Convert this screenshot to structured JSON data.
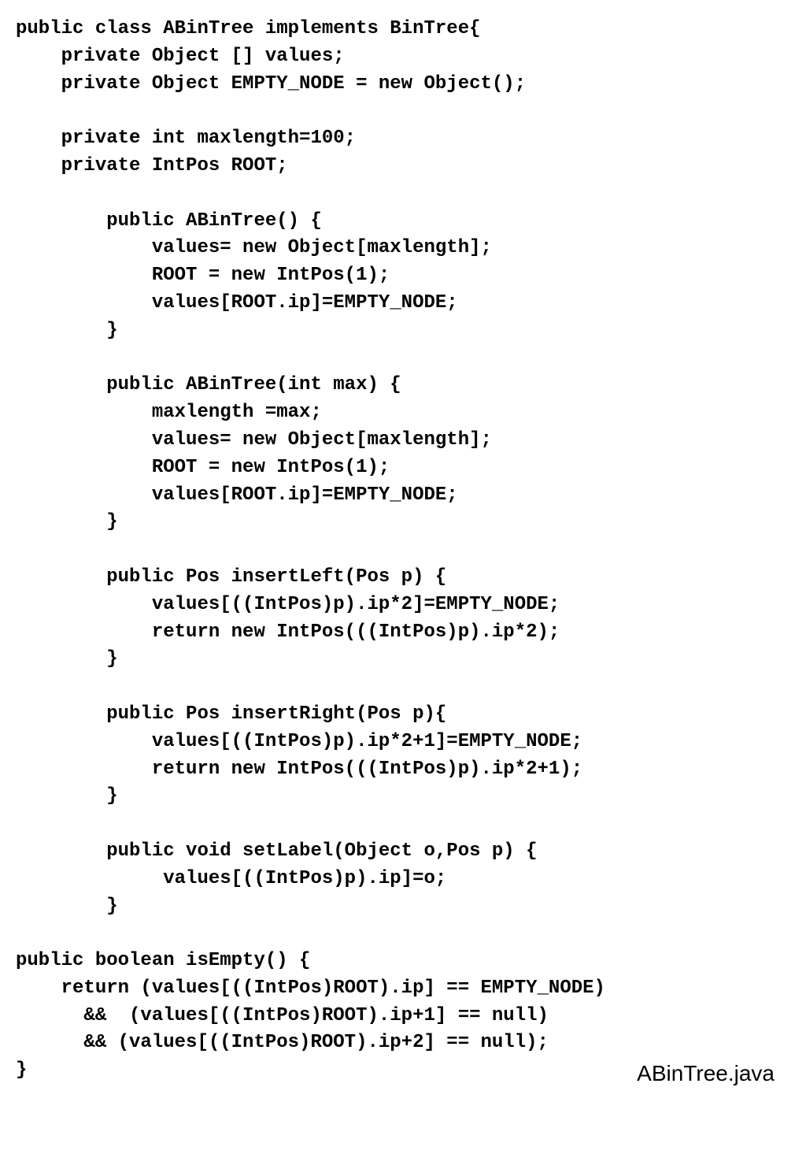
{
  "code": {
    "lines": [
      "public class ABinTree implements BinTree{",
      "    private Object [] values;",
      "    private Object EMPTY_NODE = new Object();",
      "",
      "    private int maxlength=100;",
      "    private IntPos ROOT;",
      "",
      "        public ABinTree() {",
      "            values= new Object[maxlength];",
      "            ROOT = new IntPos(1);",
      "            values[ROOT.ip]=EMPTY_NODE;",
      "        }",
      "",
      "        public ABinTree(int max) {",
      "            maxlength =max;",
      "            values= new Object[maxlength];",
      "            ROOT = new IntPos(1);",
      "            values[ROOT.ip]=EMPTY_NODE;",
      "        }",
      "",
      "        public Pos insertLeft(Pos p) {",
      "            values[((IntPos)p).ip*2]=EMPTY_NODE;",
      "            return new IntPos(((IntPos)p).ip*2);",
      "        }",
      "",
      "        public Pos insertRight(Pos p){",
      "            values[((IntPos)p).ip*2+1]=EMPTY_NODE;",
      "            return new IntPos(((IntPos)p).ip*2+1);",
      "        }",
      "",
      "        public void setLabel(Object o,Pos p) {",
      "             values[((IntPos)p).ip]=o;",
      "        }",
      "",
      "public boolean isEmpty() {",
      "    return (values[((IntPos)ROOT).ip] == EMPTY_NODE)",
      "      &&  (values[((IntPos)ROOT).ip+1] == null)",
      "      && (values[((IntPos)ROOT).ip+2] == null);",
      "}"
    ]
  },
  "filename": "ABinTree.java"
}
